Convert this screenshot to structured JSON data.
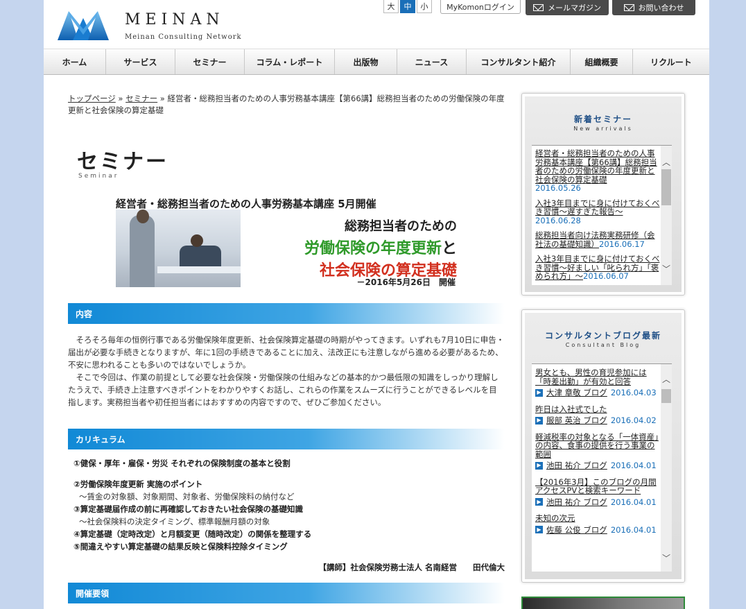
{
  "header": {
    "logo_word": "MEINAN",
    "logo_sub": "Meinan Consulting Network",
    "font_sizes": [
      "大",
      "中",
      "小"
    ],
    "mykomon": "MyKomonログイン",
    "mail_magazine": "メールマガジン",
    "contact": "お問い合わせ"
  },
  "nav": [
    "ホーム",
    "サービス",
    "セミナー",
    "コラム・レポート",
    "出版物",
    "ニュース",
    "コンサルタント紹介",
    "組織概要",
    "リクルート"
  ],
  "breadcrumb": {
    "home": "トップページ",
    "sep1": " » ",
    "seminar": "セミナー",
    "sep2": " » ",
    "current": "経営者・総務担当者のための人事労務基本講座【第66講】総務担当者のための労働保険の年度更新と社会保険の算定基礎"
  },
  "page_title": "セミナー",
  "page_title_en": "Seminar",
  "banner": {
    "line1": "経営者・総務担当者のための人事労務基本講座 5月開催",
    "line2": "総務担当者のための",
    "line3_a": "労働保険の年度更新",
    "line3_b": "と",
    "line4": "社会保険の算定基礎",
    "date": "－2016年5月26日　開催"
  },
  "sections": {
    "content": "内容",
    "curriculum": "カリキュラム",
    "outline": "開催要領"
  },
  "intro": {
    "p1": "そろそろ毎年の恒例行事である労働保険年度更新、社会保険算定基礎の時期がやってきます。いずれも7月10日に申告・届出が必要な手続きとなりますが、年に1回の手続きであることに加え、法改正にも注意しながら進める必要があるため、不安に思われることも多いのではないでしょうか。",
    "p2": "そこで今回は、作業の前提として必要な社会保険・労働保険の仕組みなどの基本的かつ最低限の知識をしっかり理解したうえで、手続き上注意すべきポイントをわかりやすくお話し、これらの作業をスムーズに行うことができるレベルを目指します。実務担当者や初任担当者にはおすすめの内容ですので、ぜひご参加ください。"
  },
  "curriculum": {
    "c1": "①健保・厚年・雇保・労災 それぞれの保険制度の基本と役割",
    "c2": "②労働保険年度更新 実施のポイント",
    "c2s": "～賃金の対象額、対象期間、対象者、労働保険料の納付など",
    "c3": "③算定基礎届作成の前に再確認しておきたい社会保険の基礎知識",
    "c3s": "～社会保険料の決定タイミング、標準報酬月額の対象",
    "c4": "④算定基礎（定時改定）と月額変更（随時改定）の関係を整理する",
    "c5": "⑤間違えやすい算定基礎の結果反映と保険料控除タイミング"
  },
  "lecturer": "【講師】社会保険労務士法人 名南経営　　田代倫大",
  "sidebar": {
    "new_title": "新着セミナー",
    "new_sub": "New arrivals",
    "new_items": [
      {
        "title": "経営者・総務担当者のための人事労務基本講座【第66講】総務担当者のための労働保険の年度更新と社会保険の算定基礎",
        "date": "2016.05.26"
      },
      {
        "title": "入社3年目までに身に付けておくべき習慣～遅すぎた報告～",
        "date": "2016.06.28"
      },
      {
        "title": "総務担当者向け法務実務研修（会社法の基礎知識）",
        "date": "2016.06.17"
      },
      {
        "title": "入社3年目までに身に付けておくべき習慣～好ましい「叱られ方」「褒められ方」～",
        "date": "2016.06.07"
      }
    ],
    "blog_title": "コンサルタントブログ最新",
    "blog_sub": "Consultant Blog",
    "blog_items": [
      {
        "title": "男女とも、男性の育児参加には「時差出勤」が有効と回答",
        "author": "大津 章敬 ブログ",
        "date": "2016.04.03"
      },
      {
        "title": "昨日は入社式でした",
        "author": "服部 英治 ブログ",
        "date": "2016.04.02"
      },
      {
        "title": "軽減税率の対象となる「一体資産」の内容、食事の提供を行う事業の範囲",
        "author": "池田 祐介 ブログ",
        "date": "2016.04.01"
      },
      {
        "title": "【2016年3月】このブログの月間アクセスPVと検索キーワード",
        "author": "池田 祐介 ブログ",
        "date": "2016.04.01"
      },
      {
        "title": "未知の次元",
        "author": "佐藤 公俊 ブログ",
        "date": "2016.04.01"
      }
    ]
  },
  "colors": {
    "accent": "#1a6fb8",
    "section_gradient_start": "#1189d6",
    "green": "#2f9a2a",
    "red": "#d2301f",
    "page_bg": "#c5d5ee"
  }
}
